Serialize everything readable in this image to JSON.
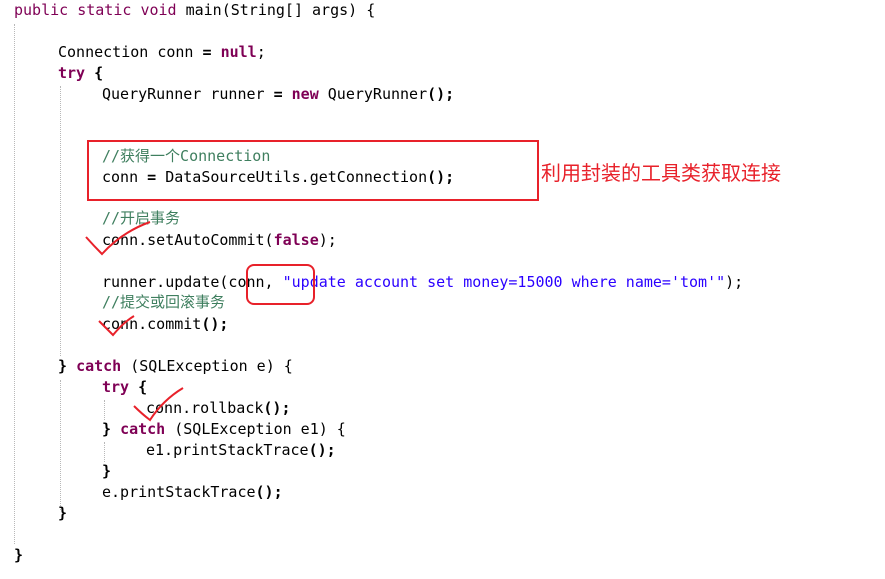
{
  "code": {
    "l1": {
      "kw1": "public",
      "kw2": "static",
      "kw3": "void",
      "name": "main",
      "rest": "(String[] args) {"
    },
    "l2": {
      "type": "Connection",
      "var": "conn",
      "eq": "=",
      "null": "null",
      "end": ";"
    },
    "l3": {
      "kw": "try",
      "brace": "{"
    },
    "l4": {
      "type": "QueryRunner",
      "var": "runner",
      "eq": "=",
      "new": "new",
      "call": "QueryRunner",
      "end": "();"
    },
    "l5": {
      "comment": "//获得一个Connection"
    },
    "l6": {
      "a": "conn",
      "eq": "=",
      "b": "DataSourceUtils.getConnection",
      "end": "();"
    },
    "l7": {
      "comment": "//开启事务"
    },
    "l8": {
      "a": "conn.setAutoCommit(",
      "false": "false",
      "end": ");"
    },
    "l9": {
      "a": "runner.update(conn, ",
      "str": "\"update account set money=15000 where name='tom'\"",
      "end": ");"
    },
    "l10": {
      "comment": "//提交或回滚事务"
    },
    "l11": {
      "a": "conn.commit",
      "end": "();"
    },
    "l12": {
      "open": "}",
      "catch": "catch",
      "rest": "(SQLException e) {"
    },
    "l13": {
      "kw": "try",
      "brace": "{"
    },
    "l14": {
      "a": "conn.rollback",
      "end": "();"
    },
    "l15": {
      "open": "}",
      "catch": "catch",
      "rest": "(SQLException e1) {"
    },
    "l16": {
      "a": "e1.printStackTrace",
      "end": "();"
    },
    "l17": {
      "text": "}"
    },
    "l18": {
      "a": "e.printStackTrace",
      "end": "();"
    },
    "l19": {
      "text": "}"
    },
    "l20": {
      "text": "}"
    }
  },
  "annotation": {
    "text": "利用封装的工具类获取连接",
    "color": "#e8212a"
  },
  "colors": {
    "keyword": "#7f0055",
    "string": "#2a00ff",
    "comment": "#3f7f5f",
    "annotation_red": "#e8212a"
  }
}
